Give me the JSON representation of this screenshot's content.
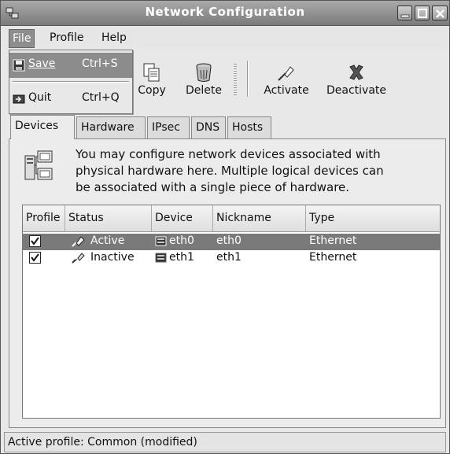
{
  "window": {
    "title": "Network Configuration"
  },
  "menubar": {
    "file": "File",
    "profile": "Profile",
    "help": "Help"
  },
  "file_menu": {
    "items": [
      {
        "label": "Save",
        "accelerator": "Ctrl+S",
        "icon": "floppy-save-icon"
      },
      {
        "label": "Quit",
        "accelerator": "Ctrl+Q",
        "icon": "quit-icon"
      }
    ]
  },
  "toolbar": {
    "copy": "Copy",
    "delete": "Delete",
    "activate": "Activate",
    "deactivate": "Deactivate"
  },
  "tabs": [
    {
      "label": "Devices",
      "active": true
    },
    {
      "label": "Hardware",
      "active": false
    },
    {
      "label": "IPsec",
      "active": false
    },
    {
      "label": "DNS",
      "active": false
    },
    {
      "label": "Hosts",
      "active": false
    }
  ],
  "devices_panel": {
    "intro_line1": "You may configure network devices associated with",
    "intro_line2": "physical hardware here.  Multiple logical devices can",
    "intro_line3": "be associated with a single piece of hardware.",
    "columns": [
      "Profile",
      "Status",
      "Device",
      "Nickname",
      "Type"
    ],
    "rows": [
      {
        "profile_checked": true,
        "status": "Active",
        "device": "eth0",
        "nickname": "eth0",
        "type": "Ethernet",
        "selected": true
      },
      {
        "profile_checked": true,
        "status": "Inactive",
        "device": "eth1",
        "nickname": "eth1",
        "type": "Ethernet",
        "selected": false
      }
    ]
  },
  "statusbar": {
    "text": "Active profile: Common (modified)"
  },
  "colors": {
    "titlebar": "#8f8f8f",
    "selection": "#7a7a7a",
    "background": "#e8e8e8"
  }
}
